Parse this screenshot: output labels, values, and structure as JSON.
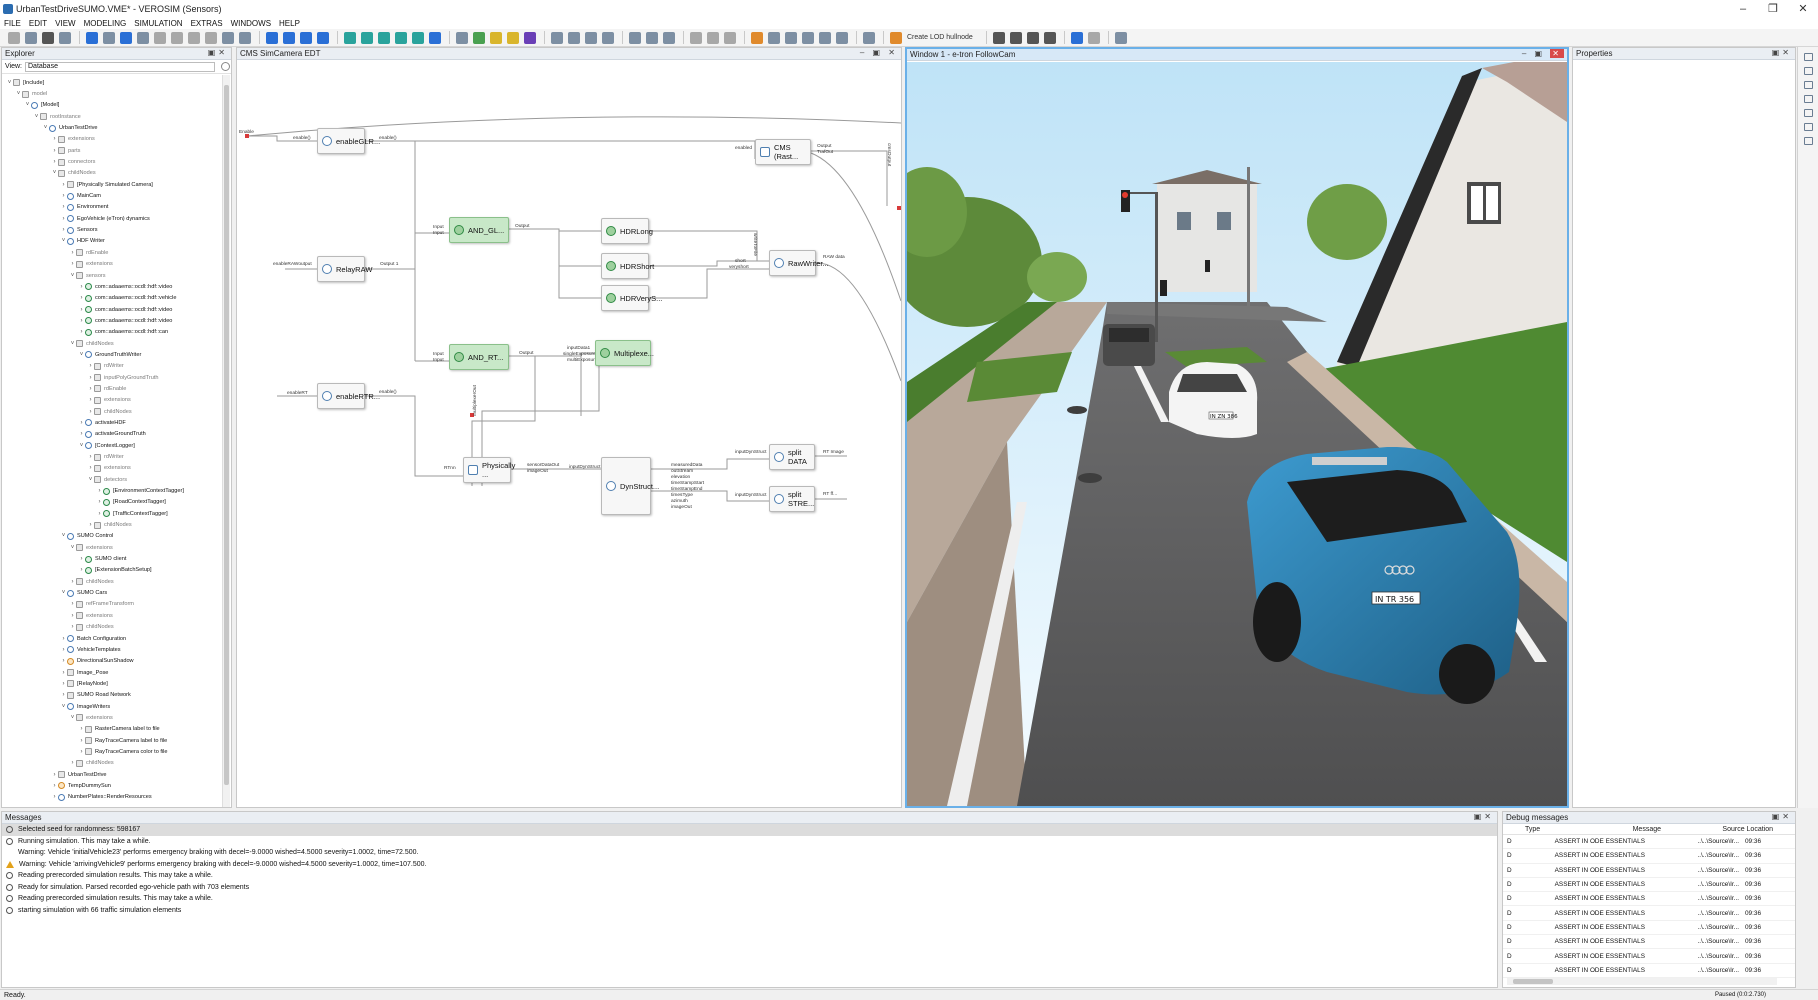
{
  "titlebar": {
    "title": "UrbanTestDriveSUMO.VME* - VEROSIM (Sensors)"
  },
  "menu": [
    "FILE",
    "EDIT",
    "VIEW",
    "MODELING",
    "SIMULATION",
    "EXTRAS",
    "WINDOWS",
    "HELP"
  ],
  "toolbar": {
    "create_lod_label": "Create LOD hullnode"
  },
  "explorer": {
    "title": "Explorer",
    "view_label": "View:",
    "view_value": "Database",
    "tree": [
      {
        "label": "[Include]",
        "depth": 0,
        "icon": "sq",
        "open": true
      },
      {
        "label": "model",
        "depth": 1,
        "icon": "sq",
        "open": true,
        "dim": true
      },
      {
        "label": "[Model]",
        "depth": 2,
        "icon": "",
        "open": true
      },
      {
        "label": "rootInstance",
        "depth": 3,
        "icon": "sq",
        "open": true,
        "dim": true
      },
      {
        "label": "UrbanTestDrive",
        "depth": 4,
        "icon": "",
        "open": true
      },
      {
        "label": "extensions",
        "depth": 5,
        "icon": "sq",
        "dim": true
      },
      {
        "label": "parts",
        "depth": 5,
        "icon": "sq",
        "dim": true
      },
      {
        "label": "connectors",
        "depth": 5,
        "icon": "sq",
        "dim": true
      },
      {
        "label": "childNodes",
        "depth": 5,
        "icon": "sq",
        "open": true,
        "dim": true
      },
      {
        "label": "[Physically Simulated Camera]",
        "depth": 6,
        "icon": "sq"
      },
      {
        "label": "MainCam",
        "depth": 6,
        "icon": ""
      },
      {
        "label": "Environment",
        "depth": 6,
        "icon": ""
      },
      {
        "label": "EgoVehicle (eTron) dynamics",
        "depth": 6,
        "icon": ""
      },
      {
        "label": "Sensors",
        "depth": 6,
        "icon": ""
      },
      {
        "label": "HDF Writer",
        "depth": 6,
        "icon": "",
        "open": true
      },
      {
        "label": "rdEnable",
        "depth": 7,
        "icon": "sq",
        "dim": true
      },
      {
        "label": "extensions",
        "depth": 7,
        "icon": "sq",
        "dim": true
      },
      {
        "label": "sensors",
        "depth": 7,
        "icon": "sq",
        "open": true,
        "dim": true
      },
      {
        "label": "com::adaaems::ocdl::hdf::video",
        "depth": 8,
        "icon": "grn"
      },
      {
        "label": "com::adaaems::ocdl::hdf::vehicle",
        "depth": 8,
        "icon": "grn"
      },
      {
        "label": "com::adaaems::ocdl::hdf::video",
        "depth": 8,
        "icon": "grn"
      },
      {
        "label": "com::adaaems::ocdl::hdf::video",
        "depth": 8,
        "icon": "grn"
      },
      {
        "label": "com::adaaems::ocdl::hdf::can",
        "depth": 8,
        "icon": "grn"
      },
      {
        "label": "childNodes",
        "depth": 7,
        "icon": "sq",
        "open": true,
        "dim": true
      },
      {
        "label": "GroundTruthWriter",
        "depth": 8,
        "icon": "",
        "open": true
      },
      {
        "label": "rdWriter",
        "depth": 9,
        "icon": "sq",
        "dim": true
      },
      {
        "label": "inputPolyGroundTruth",
        "depth": 9,
        "icon": "sq",
        "dim": true
      },
      {
        "label": "rdEnable",
        "depth": 9,
        "icon": "sq",
        "dim": true
      },
      {
        "label": "extensions",
        "depth": 9,
        "icon": "sq",
        "dim": true
      },
      {
        "label": "childNodes",
        "depth": 9,
        "icon": "sq",
        "dim": true
      },
      {
        "label": "activateHDF",
        "depth": 8,
        "icon": ""
      },
      {
        "label": "activateGroundTruth",
        "depth": 8,
        "icon": ""
      },
      {
        "label": "[ContextLogger]",
        "depth": 8,
        "icon": "",
        "open": true
      },
      {
        "label": "rdWriter",
        "depth": 9,
        "icon": "sq",
        "dim": true
      },
      {
        "label": "extensions",
        "depth": 9,
        "icon": "sq",
        "dim": true
      },
      {
        "label": "detectors",
        "depth": 9,
        "icon": "sq",
        "open": true,
        "dim": true
      },
      {
        "label": "[EnvironmentContextTagger]",
        "depth": 10,
        "icon": "grn"
      },
      {
        "label": "[RoadContextTagger]",
        "depth": 10,
        "icon": "grn"
      },
      {
        "label": "[TrafficContextTagger]",
        "depth": 10,
        "icon": "grn"
      },
      {
        "label": "childNodes",
        "depth": 9,
        "icon": "sq",
        "dim": true
      },
      {
        "label": "SUMO Control",
        "depth": 6,
        "icon": "",
        "open": true
      },
      {
        "label": "extensions",
        "depth": 7,
        "icon": "sq",
        "open": true,
        "dim": true
      },
      {
        "label": "SUMO client",
        "depth": 8,
        "icon": "grn"
      },
      {
        "label": "[ExtensionBatchSetup]",
        "depth": 8,
        "icon": "grn"
      },
      {
        "label": "childNodes",
        "depth": 7,
        "icon": "sq",
        "dim": true
      },
      {
        "label": "SUMO Cars",
        "depth": 6,
        "icon": "",
        "open": true
      },
      {
        "label": "refFrameTransform",
        "depth": 7,
        "icon": "sq",
        "dim": true
      },
      {
        "label": "extensions",
        "depth": 7,
        "icon": "sq",
        "dim": true
      },
      {
        "label": "childNodes",
        "depth": 7,
        "icon": "sq",
        "dim": true
      },
      {
        "label": "Batch Configuration",
        "depth": 6,
        "icon": ""
      },
      {
        "label": "VehicleTemplates",
        "depth": 6,
        "icon": ""
      },
      {
        "label": "DirectionalSunShadow",
        "depth": 6,
        "icon": "org"
      },
      {
        "label": "Image_Pose",
        "depth": 6,
        "icon": "sq"
      },
      {
        "label": "[RelayNode]",
        "depth": 6,
        "icon": "sq"
      },
      {
        "label": "SUMO Road Network",
        "depth": 6,
        "icon": "sq"
      },
      {
        "label": "ImageWriters",
        "depth": 6,
        "icon": "",
        "open": true
      },
      {
        "label": "extensions",
        "depth": 7,
        "icon": "sq",
        "open": true,
        "dim": true
      },
      {
        "label": "RasterCamera label to file",
        "depth": 8,
        "icon": "sq"
      },
      {
        "label": "RayTraceCamera label to file",
        "depth": 8,
        "icon": "sq"
      },
      {
        "label": "RayTraceCamera color to file",
        "depth": 8,
        "icon": "sq"
      },
      {
        "label": "childNodes",
        "depth": 7,
        "icon": "sq",
        "dim": true
      },
      {
        "label": "UrbanTestDrive",
        "depth": 5,
        "icon": "sq"
      },
      {
        "label": "TempDummySun",
        "depth": 5,
        "icon": "org"
      },
      {
        "label": "NumberPlates::RenderResources",
        "depth": 5,
        "icon": ""
      }
    ]
  },
  "editor": {
    "title": "CMS SimCamera EDT",
    "nodes": [
      {
        "id": "n_enableglr",
        "label": "enableGLR...",
        "green": false
      },
      {
        "id": "n_relayraw",
        "label": "RelayRAW",
        "green": false
      },
      {
        "id": "n_enablertr",
        "label": "enableRTR...",
        "green": false
      },
      {
        "id": "n_andgl",
        "label": "AND_GL...",
        "green": true
      },
      {
        "id": "n_andrt",
        "label": "AND_RT...",
        "green": true
      },
      {
        "id": "n_hdrlong",
        "label": "HDRLong",
        "green": false
      },
      {
        "id": "n_hdrshort",
        "label": "HDRShort",
        "green": false
      },
      {
        "id": "n_hdrvery",
        "label": "HDRVeryS...",
        "green": false
      },
      {
        "id": "n_multiplex",
        "label": "Multiplexe...",
        "green": true
      },
      {
        "id": "n_cms",
        "label": "CMS (Rast...",
        "green": false
      },
      {
        "id": "n_rawwriter",
        "label": "RawWriter...",
        "green": false
      },
      {
        "id": "n_physically",
        "label": "Physically ...",
        "green": false
      },
      {
        "id": "n_dynstruct",
        "label": "DynStruct...",
        "green": false
      },
      {
        "id": "n_splitdata",
        "label": "split DATA",
        "green": false
      },
      {
        "id": "n_splitstre",
        "label": "split STRE...",
        "green": false
      }
    ],
    "ports": {
      "enable_in": "Enable",
      "enablei": "enable()",
      "enableglr_out": "enable()",
      "enabled_cms": "enabled",
      "output_cms": "Output",
      "trafout": "TrafOut",
      "raw_rawrom": "enableRAWoutput",
      "output1": "Output 1",
      "input1": "Input",
      "input2": "Input",
      "output_and": "Output",
      "short": "short",
      "veryshort": "veryshort",
      "raw_data": "RAW data",
      "enable_rt": "enableRT",
      "enable2": "enable()",
      "input3": "Input",
      "input4": "Input",
      "output_andrt": "Output",
      "inputdata1": "inputData1",
      "singleexposure": "singleExposure",
      "multiexposure": "multiExposure",
      "rtnn": "RTnn",
      "sensordataout": "sensorDataOut",
      "imageout": "imageOut",
      "inputdynstruct": "inputDynStruct",
      "measureddata": "measuredData",
      "outstream": "outStream",
      "elevation": "elevation",
      "timestampstart": "timeStampStart",
      "timestampend": "timeStampEnd",
      "timestype": "timesType",
      "azimuth": "azimuth",
      "imageout2": "imageOut",
      "inputdynstruct2": "inputDynStruct",
      "rt_image": "RT Image",
      "inputdynstruct3": "inputDynStruct",
      "rt_dots": "RT ff...",
      "writetofile": "writeToFile",
      "multiplexerout": "multiplexerOut",
      "cmsout": "cmsOutput"
    }
  },
  "view3d": {
    "title": "Window 1 - e-tron FollowCam",
    "plate_blue": "IN TR 356",
    "plate_white": "IN ZN 386"
  },
  "properties": {
    "title": "Properties"
  },
  "messages": {
    "title": "Messages",
    "rows": [
      {
        "text": "Selected seed for randomness: 598167",
        "type": "info",
        "selected": true
      },
      {
        "text": "Running simulation. This may take a while.",
        "type": "info"
      },
      {
        "text": "Warning: Vehicle 'initialVehicle23' performs emergency braking with decel=-9.0000 wished=4.5000 severity=1.0002, time=72.500.",
        "type": "none",
        "indent": true
      },
      {
        "text": "Warning: Vehicle 'arrivingVehicle9' performs emergency braking with decel=-9.0000 wished=4.5000 severity=1.0002, time=107.500.",
        "type": "warn"
      },
      {
        "text": "Reading prerecorded simulation results. This may take a while.",
        "type": "info"
      },
      {
        "text": "Ready for simulation. Parsed recorded ego-vehicle path with 703 elements",
        "type": "info"
      },
      {
        "text": "Reading prerecorded simulation results. This may take a while.",
        "type": "info"
      },
      {
        "text": "starting simulation with 66 traffic simulation elements",
        "type": "info"
      }
    ]
  },
  "debug": {
    "title": "Debug messages",
    "columns": [
      "Type",
      "Message",
      "Source Location"
    ],
    "rows": [
      {
        "type": "D",
        "message": "ASSERT IN ODE ESSENTIALS",
        "source": "..\\..\\Source\\Ir...",
        "time": "09:36"
      },
      {
        "type": "D",
        "message": "ASSERT IN ODE ESSENTIALS",
        "source": "..\\..\\Source\\Ir...",
        "time": "09:36"
      },
      {
        "type": "D",
        "message": "ASSERT IN ODE ESSENTIALS",
        "source": "..\\..\\Source\\Ir...",
        "time": "09:36"
      },
      {
        "type": "D",
        "message": "ASSERT IN ODE ESSENTIALS",
        "source": "..\\..\\Source\\Ir...",
        "time": "09:36"
      },
      {
        "type": "D",
        "message": "ASSERT IN ODE ESSENTIALS",
        "source": "..\\..\\Source\\Ir...",
        "time": "09:36"
      },
      {
        "type": "D",
        "message": "ASSERT IN ODE ESSENTIALS",
        "source": "..\\..\\Source\\Ir...",
        "time": "09:36"
      },
      {
        "type": "D",
        "message": "ASSERT IN ODE ESSENTIALS",
        "source": "..\\..\\Source\\Ir...",
        "time": "09:36"
      },
      {
        "type": "D",
        "message": "ASSERT IN ODE ESSENTIALS",
        "source": "..\\..\\Source\\Ir...",
        "time": "09:36"
      },
      {
        "type": "D",
        "message": "ASSERT IN ODE ESSENTIALS",
        "source": "..\\..\\Source\\Ir...",
        "time": "09:36"
      },
      {
        "type": "D",
        "message": "ASSERT IN ODE ESSENTIALS",
        "source": "..\\..\\Source\\Ir...",
        "time": "09:36"
      }
    ]
  },
  "status": {
    "left": "Ready.",
    "right": "Paused (0:0:2.730)"
  }
}
